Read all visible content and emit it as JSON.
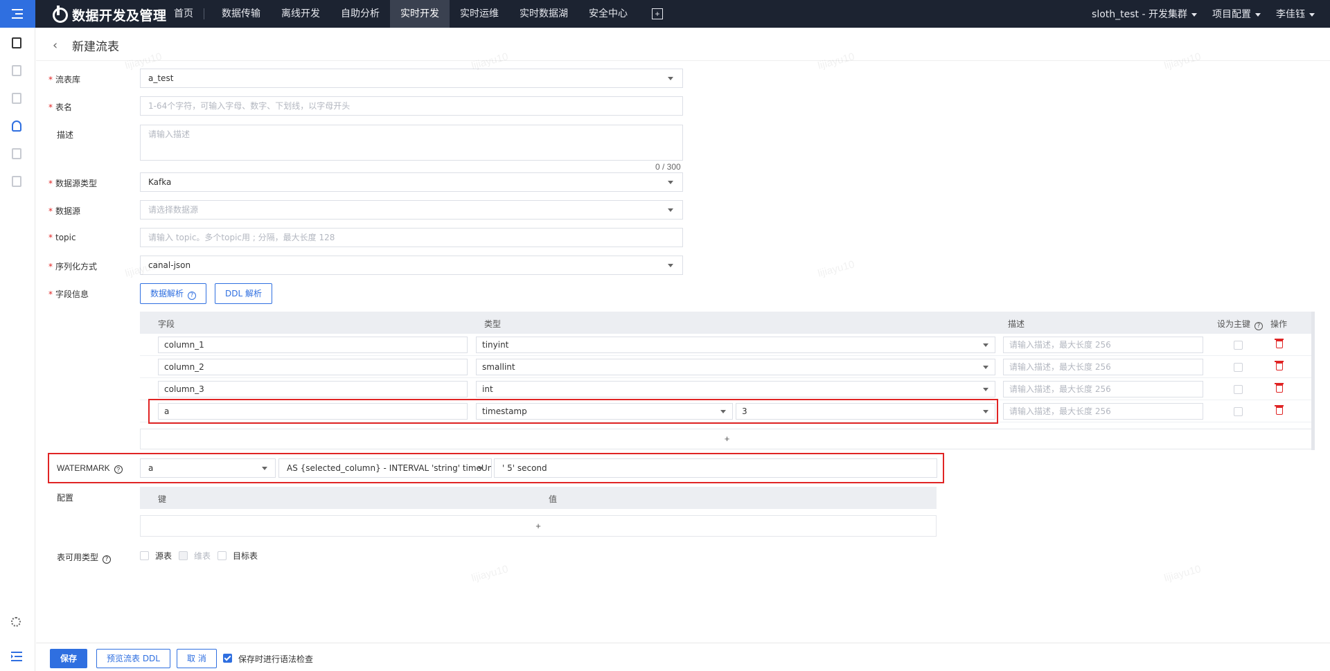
{
  "header": {
    "app_title": "数据开发及管理",
    "nav": [
      "首页",
      "数据传输",
      "离线开发",
      "自助分析",
      "实时开发",
      "实时运维",
      "实时数据湖",
      "安全中心"
    ],
    "active_nav": "实时开发",
    "cluster": "sloth_test - 开发集群",
    "project_config": "项目配置",
    "user": "李佳钰"
  },
  "page": {
    "title": "新建流表",
    "watermark_user": "lijiayu10"
  },
  "form": {
    "stream_db": {
      "label": "流表库",
      "value": "a_test"
    },
    "table_name": {
      "label": "表名",
      "placeholder": "1-64个字符，可输入字母、数字、下划线，以字母开头"
    },
    "description": {
      "label": "描述",
      "placeholder": "请输入描述",
      "counter": "0 / 300"
    },
    "source_type": {
      "label": "数据源类型",
      "value": "Kafka"
    },
    "datasource": {
      "label": "数据源",
      "placeholder": "请选择数据源"
    },
    "topic": {
      "label": "topic",
      "placeholder": "请输入 topic。多个topic用 ; 分隔，最大长度 128"
    },
    "serialization": {
      "label": "序列化方式",
      "value": "canal-json"
    },
    "fields": {
      "label": "字段信息",
      "parse_data_btn": "数据解析",
      "ddl_parse_btn": "DDL 解析",
      "columns": {
        "field": "字段",
        "type": "类型",
        "desc": "描述",
        "primary_key": "设为主键",
        "action": "操作"
      },
      "desc_placeholder": "请输入描述，最大长度 256",
      "rows": [
        {
          "name": "column_1",
          "type": "tinyint",
          "precision": ""
        },
        {
          "name": "column_2",
          "type": "smallint",
          "precision": ""
        },
        {
          "name": "column_3",
          "type": "int",
          "precision": ""
        },
        {
          "name": "a",
          "type": "timestamp",
          "precision": "3"
        }
      ],
      "add": "+"
    },
    "watermark": {
      "label": "WATERMARK",
      "column": "a",
      "expression": "AS {selected_column} - INTERVAL 'string' timeUnit",
      "interval": "' 5' second"
    },
    "config": {
      "label": "配置",
      "key_col": "键",
      "value_col": "值",
      "add": "+"
    },
    "table_types": {
      "label": "表可用类型",
      "options": [
        {
          "label": "源表",
          "disabled": false
        },
        {
          "label": "维表",
          "disabled": true
        },
        {
          "label": "目标表",
          "disabled": false
        }
      ]
    }
  },
  "footer": {
    "save": "保存",
    "preview_ddl": "预览流表 DDL",
    "cancel": "取 消",
    "syntax_check": "保存时进行语法检查",
    "syntax_check_on": true
  },
  "colors": {
    "primary": "#2f6fe0",
    "nav_bg": "#1c2331",
    "danger": "#e02424"
  }
}
